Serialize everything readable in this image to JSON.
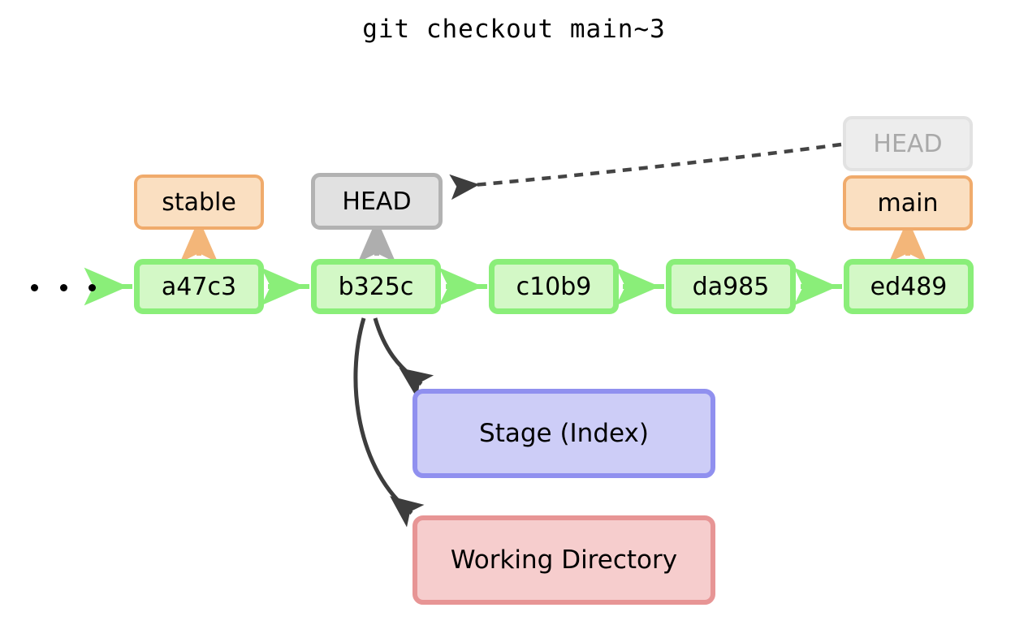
{
  "title": "git checkout main~3",
  "diagram": {
    "type": "git-state-diagram",
    "ellipsis": "· · ·",
    "commits": [
      {
        "id": "a47c3",
        "label": "a47c3"
      },
      {
        "id": "b325c",
        "label": "b325c"
      },
      {
        "id": "c10b9",
        "label": "c10b9"
      },
      {
        "id": "da985",
        "label": "da985"
      },
      {
        "id": "ed489",
        "label": "ed489"
      }
    ],
    "refs": [
      {
        "id": "stable",
        "label": "stable",
        "kind": "branch",
        "points_to": "a47c3"
      },
      {
        "id": "head-detached",
        "label": "HEAD",
        "kind": "head",
        "points_to": "b325c"
      },
      {
        "id": "head-ghost",
        "label": "HEAD",
        "kind": "head-previous",
        "points_to": "main"
      },
      {
        "id": "main",
        "label": "main",
        "kind": "branch",
        "points_to": "ed489"
      }
    ],
    "areas": [
      {
        "id": "stage",
        "label": "Stage (Index)"
      },
      {
        "id": "working-directory",
        "label": "Working Directory"
      }
    ],
    "edges": [
      {
        "from": "a47c3",
        "to": "ellipsis",
        "style": "solid",
        "color": "#8aee79"
      },
      {
        "from": "b325c",
        "to": "a47c3",
        "style": "solid",
        "color": "#8aee79"
      },
      {
        "from": "c10b9",
        "to": "b325c",
        "style": "solid",
        "color": "#8aee79"
      },
      {
        "from": "da985",
        "to": "c10b9",
        "style": "solid",
        "color": "#8aee79"
      },
      {
        "from": "ed489",
        "to": "da985",
        "style": "solid",
        "color": "#8aee79"
      },
      {
        "from": "stable",
        "to": "a47c3",
        "style": "solid",
        "color": "#f3b679"
      },
      {
        "from": "main",
        "to": "ed489",
        "style": "solid",
        "color": "#f3b679"
      },
      {
        "from": "head-detached",
        "to": "b325c",
        "style": "solid",
        "color": "#aeaeae"
      },
      {
        "from": "head-ghost",
        "to": "head-detached",
        "style": "dashed",
        "color": "#444444"
      },
      {
        "from": "b325c",
        "to": "stage",
        "style": "solid",
        "color": "#3d3d3d"
      },
      {
        "from": "b325c",
        "to": "working-directory",
        "style": "solid",
        "color": "#3d3d3d"
      }
    ]
  },
  "colors": {
    "commit_fill": "#d3f8c6",
    "commit_border": "#8aee79",
    "branch_fill": "#fadfc1",
    "branch_border": "#f0ab6c",
    "head_fill": "#e1e1e1",
    "head_border": "#b2b2b2",
    "head_ghost_fill": "#ededed",
    "head_ghost_text": "#a9a9a9",
    "stage_fill": "#cdcdf7",
    "stage_border": "#9090ef",
    "working_fill": "#f6cdcd",
    "working_border": "#e79595",
    "arrow_dark": "#3d3d3d",
    "background": "#ffffff"
  }
}
